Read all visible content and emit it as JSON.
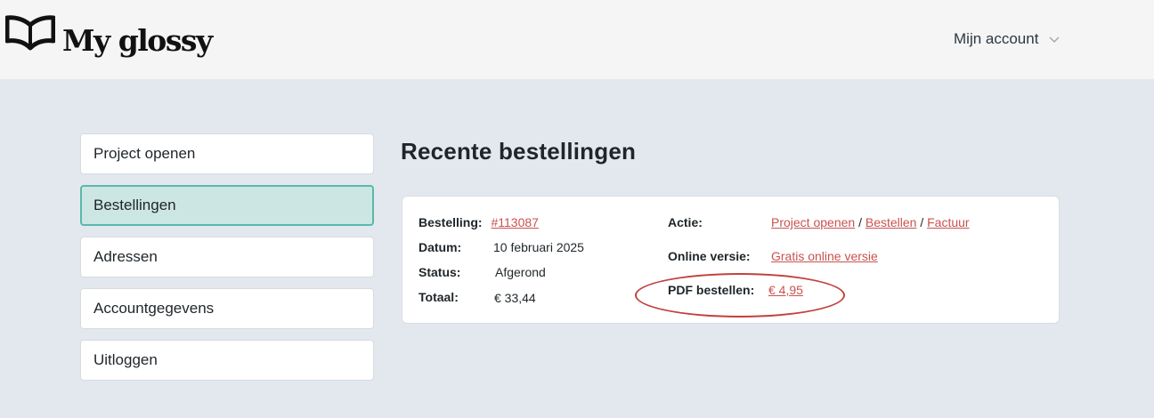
{
  "header": {
    "brand": "My glossy",
    "account_label": "Mijn account"
  },
  "sidebar": {
    "items": [
      {
        "label": "Project openen",
        "active": false
      },
      {
        "label": "Bestellingen",
        "active": true
      },
      {
        "label": "Adressen",
        "active": false
      },
      {
        "label": "Accountgegevens",
        "active": false
      },
      {
        "label": "Uitloggen",
        "active": false
      }
    ]
  },
  "main": {
    "title": "Recente bestellingen",
    "order": {
      "order_label": "Bestelling:",
      "order_number": "#113087",
      "date_label": "Datum:",
      "date_value": "10 februari 2025",
      "status_label": "Status:",
      "status_value": "Afgerond",
      "total_label": "Totaal:",
      "total_value": "€ 33,44",
      "action_label": "Actie:",
      "actions": [
        "Project openen",
        "Bestellen",
        "Factuur"
      ],
      "action_separator": " / ",
      "online_label": "Online versie:",
      "online_link": "Gratis online versie",
      "pdf_label": "PDF bestellen:",
      "pdf_price": "€ 4,95"
    }
  },
  "colors": {
    "link": "#c8534f",
    "active_bg": "#cce6e3",
    "active_border": "#5ab8ae",
    "annotation": "#c2403e",
    "page_bg": "#e3e8ee"
  }
}
